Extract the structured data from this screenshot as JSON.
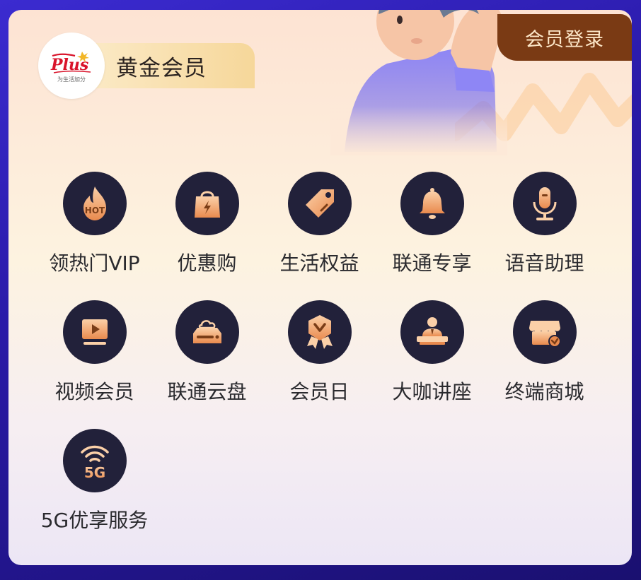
{
  "header": {
    "membership_level": "黄金会员",
    "login_label": "会员登录",
    "logo_text": "Plus",
    "logo_tagline": "为生活加分"
  },
  "services": [
    {
      "label": "领热门VIP",
      "icon": "hot-flame-icon"
    },
    {
      "label": "优惠购",
      "icon": "shopping-bag-icon"
    },
    {
      "label": "生活权益",
      "icon": "price-tag-icon"
    },
    {
      "label": "联通专享",
      "icon": "bell-icon"
    },
    {
      "label": "语音助理",
      "icon": "microphone-icon"
    },
    {
      "label": "视频会员",
      "icon": "video-play-icon"
    },
    {
      "label": "联通云盘",
      "icon": "cloud-drive-icon"
    },
    {
      "label": "会员日",
      "icon": "medal-badge-icon"
    },
    {
      "label": "大咖讲座",
      "icon": "lecture-speaker-icon"
    },
    {
      "label": "终端商城",
      "icon": "store-icon"
    },
    {
      "label": "5G优享服务",
      "icon": "5g-signal-icon"
    }
  ],
  "colors": {
    "icon_bg": "#22213a",
    "icon_accent": "#f3b27a",
    "login_bg": "#7a3a14",
    "badge_gold": "#f6d79a"
  }
}
